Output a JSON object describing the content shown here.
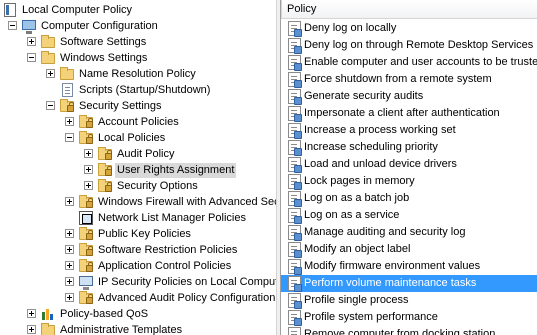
{
  "tree": {
    "items": [
      {
        "label": "Local Computer Policy",
        "icon": "local-policy-icon",
        "expander": "none",
        "selected": false
      },
      {
        "label": "Computer Configuration",
        "icon": "computer-icon",
        "expander": "minus",
        "selected": false
      },
      {
        "label": "Software Settings",
        "icon": "folder-icon",
        "expander": "plus",
        "selected": false
      },
      {
        "label": "Windows Settings",
        "icon": "folder-icon",
        "expander": "minus",
        "selected": false
      },
      {
        "label": "Name Resolution Policy",
        "icon": "folder-icon",
        "expander": "plus",
        "selected": false
      },
      {
        "label": "Scripts (Startup/Shutdown)",
        "icon": "script-icon",
        "expander": "none",
        "selected": false
      },
      {
        "label": "Security Settings",
        "icon": "security-settings-icon",
        "expander": "minus",
        "selected": false
      },
      {
        "label": "Account Policies",
        "icon": "locked-folder-icon",
        "expander": "plus",
        "selected": false
      },
      {
        "label": "Local Policies",
        "icon": "locked-folder-icon",
        "expander": "minus",
        "selected": false
      },
      {
        "label": "Audit Policy",
        "icon": "locked-folder-icon",
        "expander": "plus",
        "selected": false
      },
      {
        "label": "User Rights Assignment",
        "icon": "locked-folder-icon",
        "expander": "plus",
        "selected": true
      },
      {
        "label": "Security Options",
        "icon": "locked-folder-icon",
        "expander": "plus",
        "selected": false
      },
      {
        "label": "Windows Firewall with Advanced Sec",
        "icon": "locked-folder-icon",
        "expander": "plus",
        "selected": false
      },
      {
        "label": "Network List Manager Policies",
        "icon": "folder-icon",
        "expander": "none",
        "selected": false
      },
      {
        "label": "Public Key Policies",
        "icon": "locked-folder-icon",
        "expander": "plus",
        "selected": false
      },
      {
        "label": "Software Restriction Policies",
        "icon": "locked-folder-icon",
        "expander": "plus",
        "selected": false
      },
      {
        "label": "Application Control Policies",
        "icon": "locked-folder-icon",
        "expander": "plus",
        "selected": false
      },
      {
        "label": "IP Security Policies on Local Compute",
        "icon": "ip-security-icon",
        "expander": "plus",
        "selected": false
      },
      {
        "label": "Advanced Audit Policy Configuration",
        "icon": "locked-folder-icon",
        "expander": "plus",
        "selected": false
      },
      {
        "label": "Policy-based QoS",
        "icon": "qos-chart-icon",
        "expander": "plus",
        "selected": false
      },
      {
        "label": "Administrative Templates",
        "icon": "folder-icon",
        "expander": "plus",
        "selected": false
      }
    ]
  },
  "list": {
    "header": "Policy",
    "items": [
      {
        "label": "Deny log on locally",
        "selected": false
      },
      {
        "label": "Deny log on through Remote Desktop Services",
        "selected": false
      },
      {
        "label": "Enable computer and user accounts to be trusted",
        "selected": false
      },
      {
        "label": "Force shutdown from a remote system",
        "selected": false
      },
      {
        "label": "Generate security audits",
        "selected": false
      },
      {
        "label": "Impersonate a client after authentication",
        "selected": false
      },
      {
        "label": "Increase a process working set",
        "selected": false
      },
      {
        "label": "Increase scheduling priority",
        "selected": false
      },
      {
        "label": "Load and unload device drivers",
        "selected": false
      },
      {
        "label": "Lock pages in memory",
        "selected": false
      },
      {
        "label": "Log on as a batch job",
        "selected": false
      },
      {
        "label": "Log on as a service",
        "selected": false
      },
      {
        "label": "Manage auditing and security log",
        "selected": false
      },
      {
        "label": "Modify an object label",
        "selected": false
      },
      {
        "label": "Modify firmware environment values",
        "selected": false
      },
      {
        "label": "Perform volume maintenance tasks",
        "selected": true
      },
      {
        "label": "Profile single process",
        "selected": false
      },
      {
        "label": "Profile system performance",
        "selected": false
      },
      {
        "label": "Remove computer from docking station",
        "selected": false
      }
    ]
  },
  "colors": {
    "selection": "#3399ff",
    "tree_selection": "#d9d9d9"
  }
}
